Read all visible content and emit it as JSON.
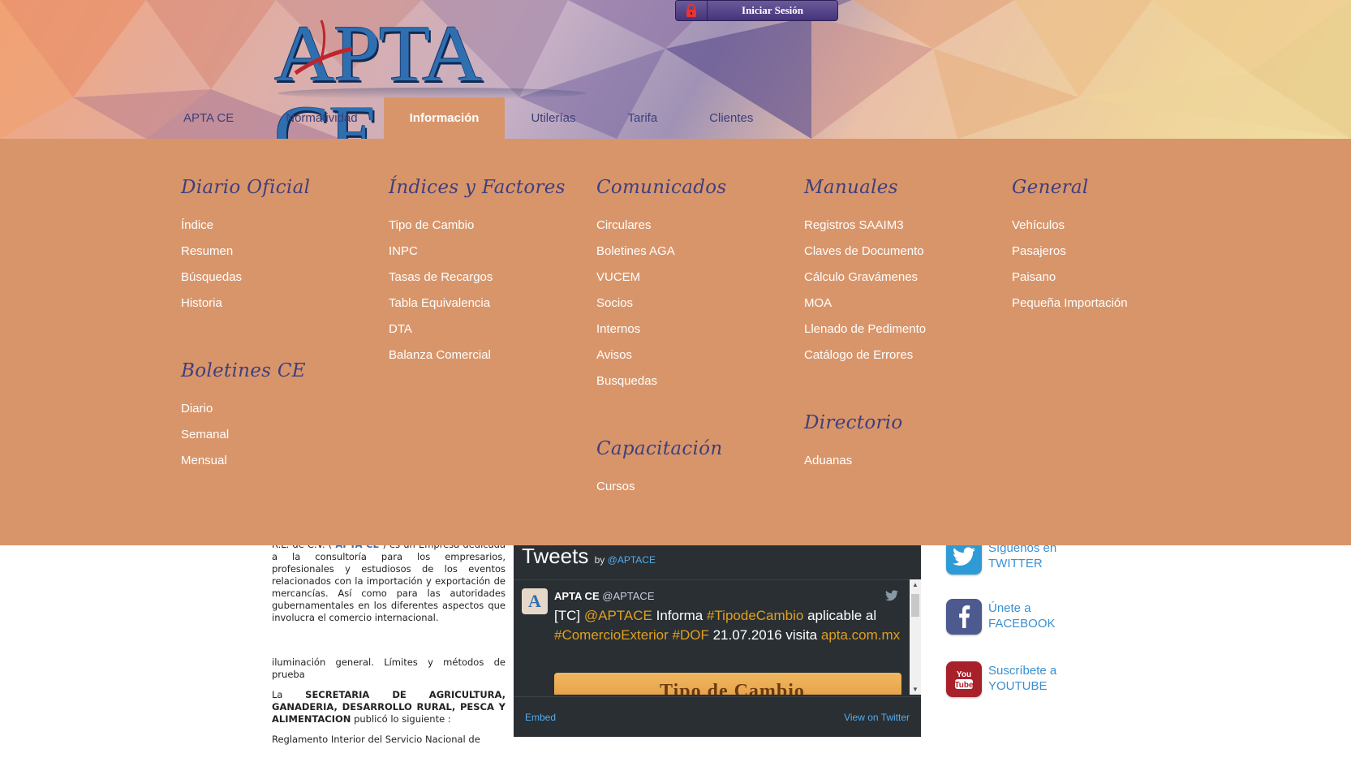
{
  "header": {
    "logo_text": "APTA CE",
    "login_label": "Iniciar Sesión",
    "nav": [
      {
        "label": "APTA CE",
        "active": false
      },
      {
        "label": "Normatividad",
        "active": false
      },
      {
        "label": "Información",
        "active": true
      },
      {
        "label": "Utilerías",
        "active": false
      },
      {
        "label": "Tarifa",
        "active": false
      },
      {
        "label": "Clientes",
        "active": false
      }
    ]
  },
  "menu": {
    "diario": {
      "title": "Diario Oficial",
      "items": [
        "Índice",
        "Resumen",
        "Búsquedas",
        "Historia"
      ]
    },
    "boletines": {
      "title": "Boletines CE",
      "items": [
        "Diario",
        "Semanal",
        "Mensual"
      ]
    },
    "indices": {
      "title": "Índices y Factores",
      "items": [
        "Tipo de Cambio",
        "INPC",
        "Tasas de Recargos",
        "Tabla Equivalencia",
        "DTA",
        "Balanza Comercial"
      ]
    },
    "comunicados": {
      "title": "Comunicados",
      "items": [
        "Circulares",
        "Boletines AGA",
        "VUCEM",
        "Socios",
        "Internos",
        "Avisos",
        "Busquedas"
      ]
    },
    "capacitacion": {
      "title": "Capacitación",
      "items": [
        "Cursos"
      ]
    },
    "manuales": {
      "title": "Manuales",
      "items": [
        "Registros SAAIM3",
        "Claves de Documento",
        "Cálculo Gravámenes",
        "MOA",
        "Llenado de Pedimento",
        "Catálogo de Errores"
      ]
    },
    "directorio": {
      "title": "Directorio",
      "items": [
        "Aduanas"
      ]
    },
    "general": {
      "title": "General",
      "items": [
        "Vehículos",
        "Pasajeros",
        "Paisano",
        "Pequeña Importación"
      ]
    }
  },
  "article": {
    "p1_prefix": "R.L. de C.V. (",
    "p1_brand": "APTA CE",
    "p1_rest": ") es un Empresa dedicada a la consultoría para los empresarios, profesionales y estudiosos de los eventos relacionados con la importación y exportación de mercancías. Así como para las autoridades gubernamentales en los diferentes aspectos que involucra el comercio internacional.",
    "p2": "iluminación general. Límites y métodos de prueba",
    "p3_prefix": "La",
    "p3_bold": "SECRETARIA DE AGRICULTURA, GANADERIA, DESARROLLO RURAL, PESCA Y ALIMENTACION",
    "p3_rest": "publicó lo siguiente :",
    "p4": "Reglamento Interior del Servicio Nacional de"
  },
  "twitter": {
    "title": "Tweets",
    "by": "by",
    "handle": "@APTACE",
    "tweet_name": "APTA CE",
    "tweet_handle": "@APTACE",
    "tweet_t1": "[TC]",
    "tweet_t2": "@APTACE",
    "tweet_t3": "Informa",
    "tweet_t4": "#TipodeCambio",
    "tweet_t5": "aplicable al",
    "tweet_t6": "#ComercioExterior",
    "tweet_t7": "#DOF",
    "tweet_t8": "21.07.2016 visita",
    "tweet_t9": "apta.com.mx",
    "image_text": "Tipo de Cambio",
    "embed": "Embed",
    "view": "View on Twitter"
  },
  "social": {
    "twitter": {
      "line1": "Síguenos en",
      "line2": "TWITTER"
    },
    "facebook": {
      "line1": "Únete a",
      "line2": "FACEBOOK"
    },
    "youtube": {
      "line1": "Suscríbete a",
      "line2": "YOUTUBE"
    }
  },
  "colors": {
    "menu_bg": "#d9956a",
    "title_color": "#3e3f7d",
    "link_color": "#3a8fd1"
  }
}
